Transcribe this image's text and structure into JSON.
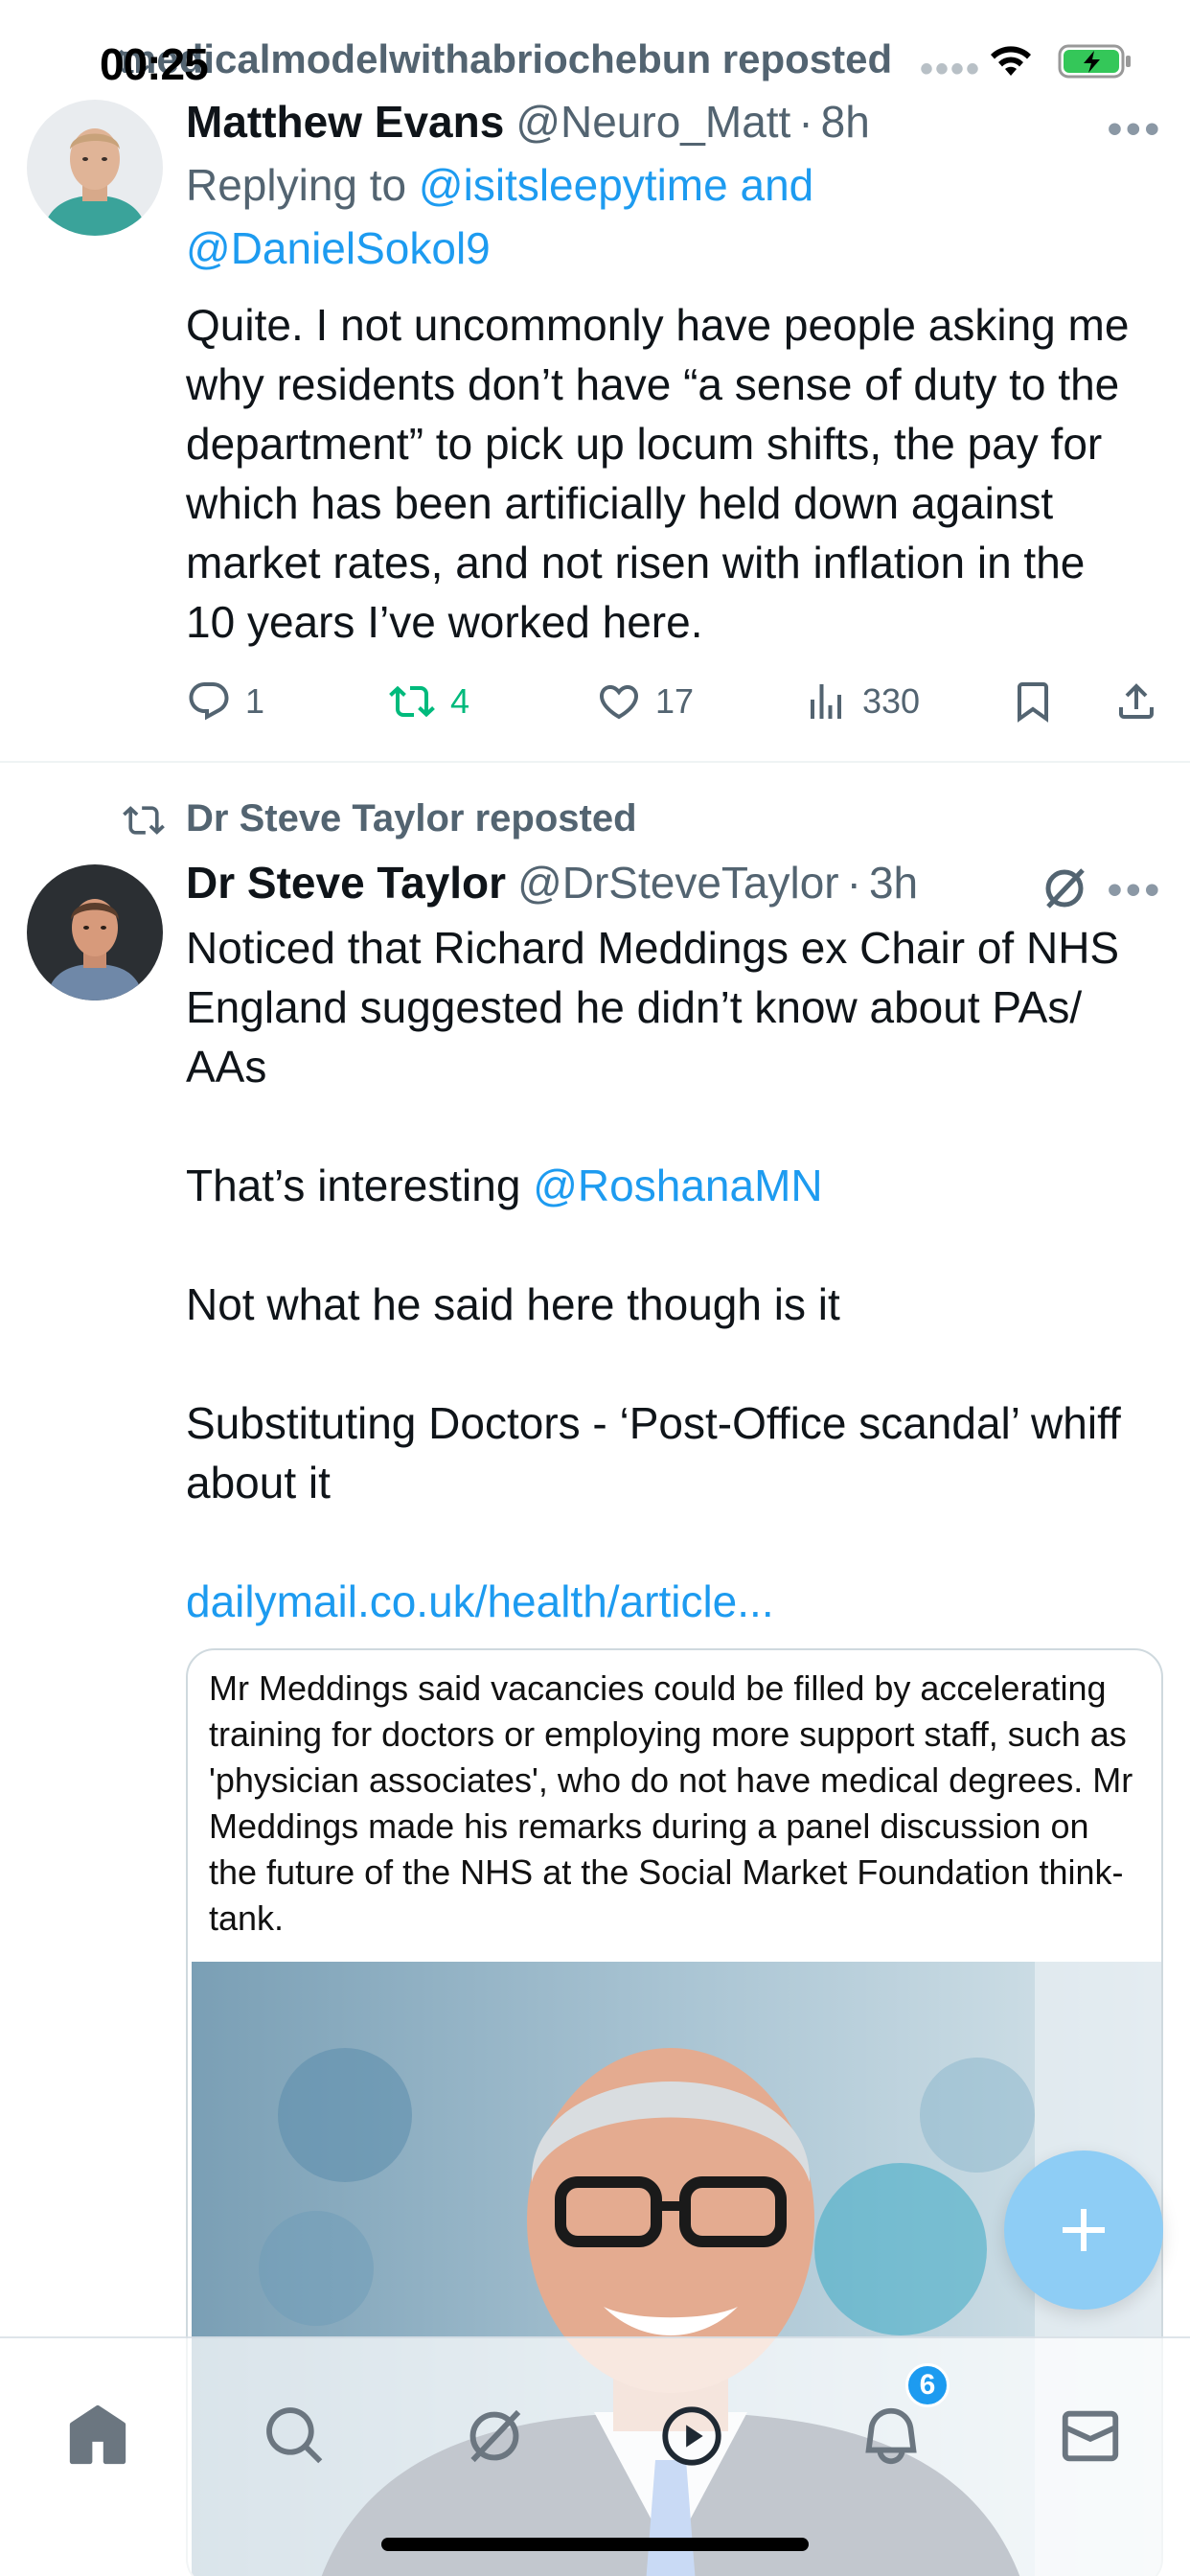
{
  "status_bar": {
    "time": "00:25",
    "top_repost_label": "medicalmodelwithabriochebun reposted",
    "faint_dots": "••••"
  },
  "tweet1": {
    "name": "Matthew Evans",
    "handle": "@Neuro_Matt",
    "separator": "·",
    "time": "8h",
    "replying_prefix": "Replying to",
    "replying_mention1": "@isitsleepytime and",
    "replying_mention2": "@DanielSokol9",
    "body": "Quite. I not uncommonly have people asking me why residents don’t have “a sense of duty to the department” to pick up locum shifts, the pay for which has been artificially held down against market rates, and not risen with inflation in the 10 years I’ve worked here.",
    "replies": "1",
    "reposts": "4",
    "likes": "17",
    "views": "330",
    "more": "•••"
  },
  "tweet2": {
    "repost_label": "Dr Steve Taylor reposted",
    "name": "Dr Steve Taylor",
    "handle": "@DrSteveTaylor",
    "separator": "·",
    "time": "3h",
    "more": "•••",
    "line1": "Noticed that Richard Meddings ex Chair of NHS England suggested he didn’t know about PAs/ AAs",
    "line2_prefix": "That’s interesting ",
    "line2_mention": "@RoshanaMN",
    "line3": "Not what he said here though is it",
    "line4": "Substituting Doctors - ‘Post-Office scandal’ whiff about it",
    "link": "dailymail.co.uk/health/article...",
    "card_text": "Mr Meddings said vacancies could be filled by accelerating training for doctors or employing more support staff, such as 'physician associates', who do not have medical degrees. Mr Meddings made his remarks during a panel discussion on the future of the NHS at the Social Market Foundation think-tank."
  },
  "nav": {
    "items": [
      "home-icon",
      "search-icon",
      "grok-icon",
      "video-icon",
      "notifications-icon",
      "messages-icon"
    ],
    "notification_count": "6"
  },
  "colors": {
    "accent": "#1d9bf0",
    "repost_green": "#00ba7c",
    "secondary_text": "#536471",
    "fab": "#8ecdf5"
  }
}
